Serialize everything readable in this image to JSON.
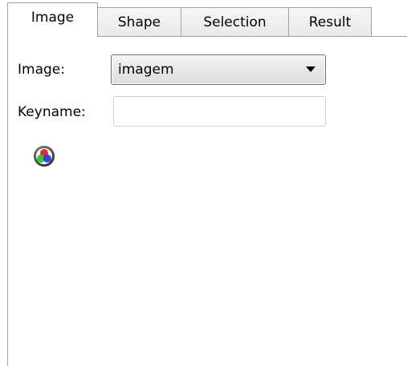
{
  "tabs": [
    {
      "label": "Image",
      "active": true
    },
    {
      "label": "Shape",
      "active": false
    },
    {
      "label": "Selection",
      "active": false
    },
    {
      "label": "Result",
      "active": false
    }
  ],
  "form": {
    "image_label": "Image:",
    "image_value": "imagem",
    "keyname_label": "Keyname:",
    "keyname_value": "",
    "color_button_icon": "rgb-color-icon"
  },
  "colors": {
    "border": "#a0a0a0",
    "rgb_red": "#e02020",
    "rgb_green": "#20c020",
    "rgb_blue": "#2030e0"
  }
}
